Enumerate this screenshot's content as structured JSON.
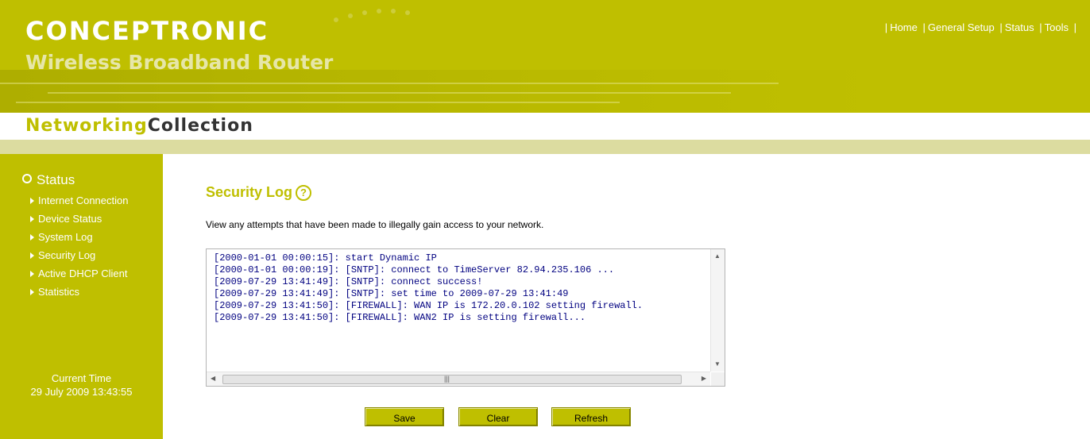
{
  "header": {
    "brand": "CONCEPTRONIC",
    "subtitle": "Wireless Broadband Router",
    "collection_a": "Networking",
    "collection_b": "Collection",
    "nav": [
      "Home",
      "General Setup",
      "Status",
      "Tools"
    ]
  },
  "sidebar": {
    "section_title": "Status",
    "items": [
      {
        "label": "Internet Connection"
      },
      {
        "label": "Device Status"
      },
      {
        "label": "System Log"
      },
      {
        "label": "Security Log"
      },
      {
        "label": "Active DHCP Client"
      },
      {
        "label": "Statistics"
      }
    ],
    "clock_label": "Current Time",
    "clock_value": "29 July 2009 13:43:55"
  },
  "main": {
    "title": "Security Log",
    "help_icon": "?",
    "description": "View any attempts that have been made to illegally gain access to your network.",
    "log_lines": [
      "[2000-01-01 00:00:15]: start Dynamic IP",
      "[2000-01-01 00:00:19]: [SNTP]: connect to TimeServer 82.94.235.106 ...",
      "[2009-07-29 13:41:49]: [SNTP]: connect success!",
      "[2009-07-29 13:41:49]: [SNTP]: set time to 2009-07-29 13:41:49",
      "[2009-07-29 13:41:50]: [FIREWALL]: WAN IP is 172.20.0.102 setting firewall.",
      "[2009-07-29 13:41:50]: [FIREWALL]: WAN2 IP is setting firewall..."
    ],
    "buttons": {
      "save": "Save",
      "clear": "Clear",
      "refresh": "Refresh"
    }
  },
  "colors": {
    "accent": "#bfbf00",
    "log_text": "#000080"
  }
}
